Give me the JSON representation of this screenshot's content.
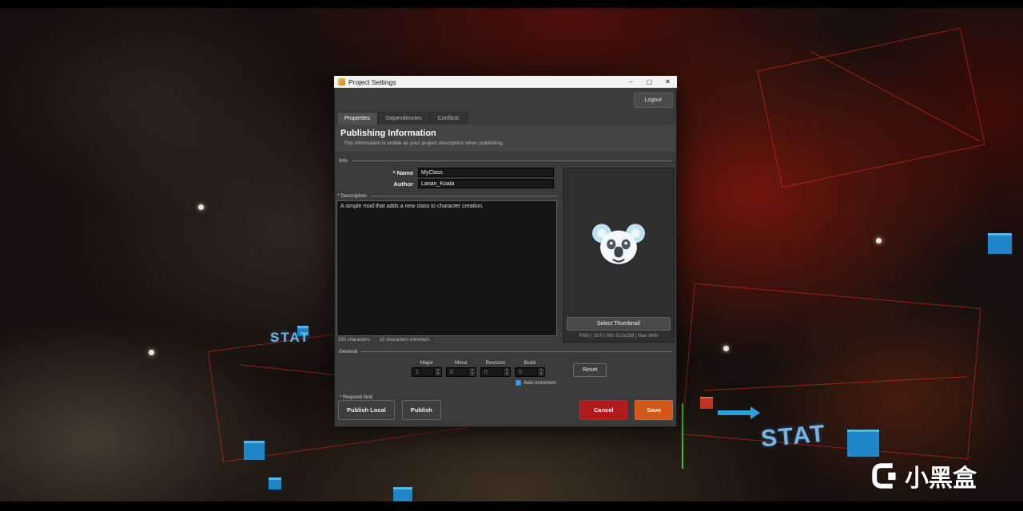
{
  "window": {
    "title": "Project Settings",
    "logout": "Logout"
  },
  "icons": {
    "minimize": "–",
    "maximize": "▢",
    "close": "✕",
    "spinner_up": "▴",
    "spinner_down": "▾",
    "check": "✓"
  },
  "tabs": [
    {
      "label": "Properties"
    },
    {
      "label": "Dependencies"
    },
    {
      "label": "Conflicts"
    }
  ],
  "publishing": {
    "heading": "Publishing Information",
    "subtitle": "This information is visible as your project description when publishing.",
    "info_section": "Info",
    "fields": {
      "name_label": "* Name",
      "name_value": "MyClass",
      "author_label": "Author",
      "author_value": "Larian_Koala"
    },
    "description_label": "* Description",
    "description_value": "A simple mod that adds a new class to character creation.",
    "char_count": "250 characters",
    "char_min": "10 characters minimum"
  },
  "thumbnail": {
    "icon": "koala",
    "select_button": "Select Thumbnail",
    "requirements": "PNG | 16:9 | Min 512x288 | Max 8Mb"
  },
  "general": {
    "section": "General",
    "versions": [
      {
        "label": "Major",
        "value": "1"
      },
      {
        "label": "Minor",
        "value": "0"
      },
      {
        "label": "Revision",
        "value": "0"
      },
      {
        "label": "Build",
        "value": "0"
      }
    ],
    "reset": "Reset",
    "auto_increment": "Auto-increment"
  },
  "footer": {
    "required_note": "* Required field",
    "publish_local": "Publish Local",
    "publish": "Publish",
    "cancel": "Cancel",
    "save": "Save"
  },
  "scene": {
    "stat": "STAT",
    "watermark": "小黑盒"
  },
  "colors": {
    "cancel": "#b2191d",
    "save": "#d2571b",
    "accent_blue": "#2d8ceb"
  }
}
